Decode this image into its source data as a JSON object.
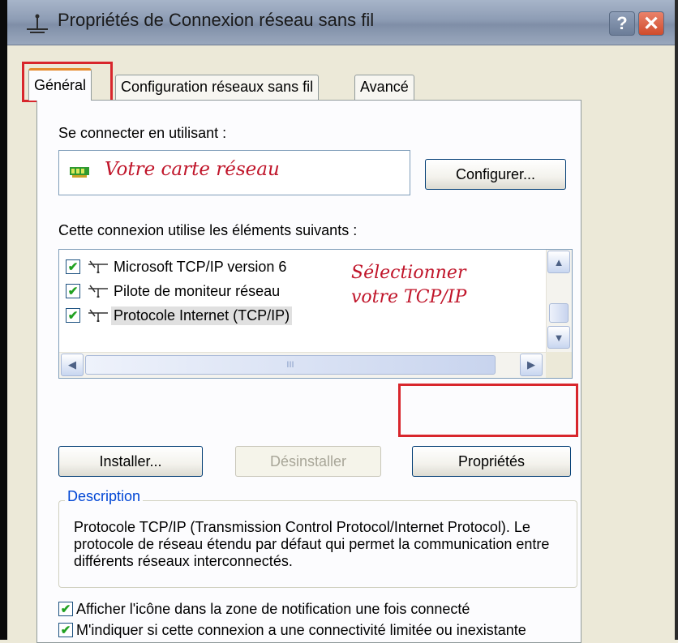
{
  "window": {
    "title": "Propriétés de Connexion réseau sans fil",
    "help_label": "?",
    "close_label": "✕"
  },
  "tabs": [
    {
      "label": "Général",
      "selected": true
    },
    {
      "label": "Configuration réseaux sans fil",
      "selected": false
    },
    {
      "label": "Avancé",
      "selected": false
    }
  ],
  "connect_using": {
    "label": "Se connecter en utilisant :",
    "adapter": "Votre carte réseau",
    "configure_button": "Configurer..."
  },
  "components": {
    "label": "Cette connexion utilise les éléments suivants :",
    "items": [
      {
        "label": "Microsoft TCP/IP version 6",
        "checked": true
      },
      {
        "label": "Pilote de moniteur réseau",
        "checked": true
      },
      {
        "label": "Protocole Internet (TCP/IP)",
        "checked": true,
        "selected": true
      }
    ],
    "annotation_line1": "Sélectionner",
    "annotation_line2": "votre TCP/IP",
    "scroll_thumb_grip": "III"
  },
  "buttons": {
    "install": "Installer...",
    "uninstall": "Désinstaller",
    "properties": "Propriétés"
  },
  "description": {
    "legend": "Description",
    "text": "Protocole TCP/IP (Transmission Control Protocol/Internet Protocol). Le protocole de réseau étendu par défaut qui permet la communication entre différents réseaux interconnectés."
  },
  "options": [
    {
      "label": "Afficher l'icône dans la zone de notification une fois connecté",
      "checked": true
    },
    {
      "label": "M'indiquer si cette connexion a une connectivité limitée ou inexistante",
      "checked": true
    }
  ],
  "colors": {
    "annotation": "#c0152a",
    "highlight_box": "#d8262c",
    "legend": "#0046d5"
  }
}
